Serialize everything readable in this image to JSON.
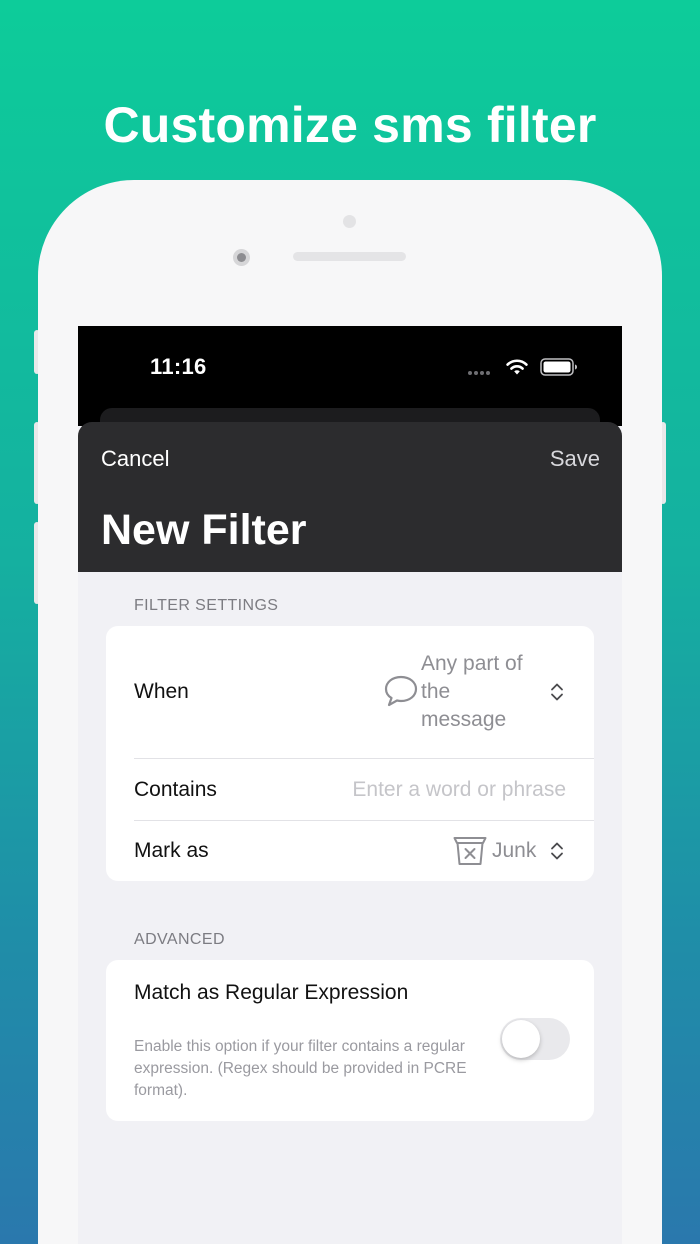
{
  "headline": "Customize sms filter",
  "status_bar": {
    "time": "11:16",
    "icons": [
      "cellular-dots-icon",
      "wifi-icon",
      "battery-icon"
    ]
  },
  "nav": {
    "cancel_label": "Cancel",
    "save_label": "Save",
    "title": "New Filter"
  },
  "filter_settings": {
    "header": "FILTER SETTINGS",
    "when": {
      "label": "When",
      "value_lines": [
        "Any part of",
        "the",
        "message"
      ],
      "icon": "speech-bubble-icon"
    },
    "contains": {
      "label": "Contains",
      "placeholder": "Enter a word or phrase"
    },
    "mark_as": {
      "label": "Mark as",
      "value": "Junk",
      "icon": "junk-bin-icon"
    }
  },
  "advanced": {
    "header": "ADVANCED",
    "regex": {
      "label": "Match as Regular Expression",
      "description": "Enable this option if your filter contains a regular expression.  (Regex should be provided in PCRE format).",
      "enabled": false
    }
  },
  "colors": {
    "gradient_top": "#0dcc9a",
    "gradient_bottom": "#2a78ad",
    "nav_background": "#2c2c2e",
    "screen_background": "#f1f1f5"
  }
}
